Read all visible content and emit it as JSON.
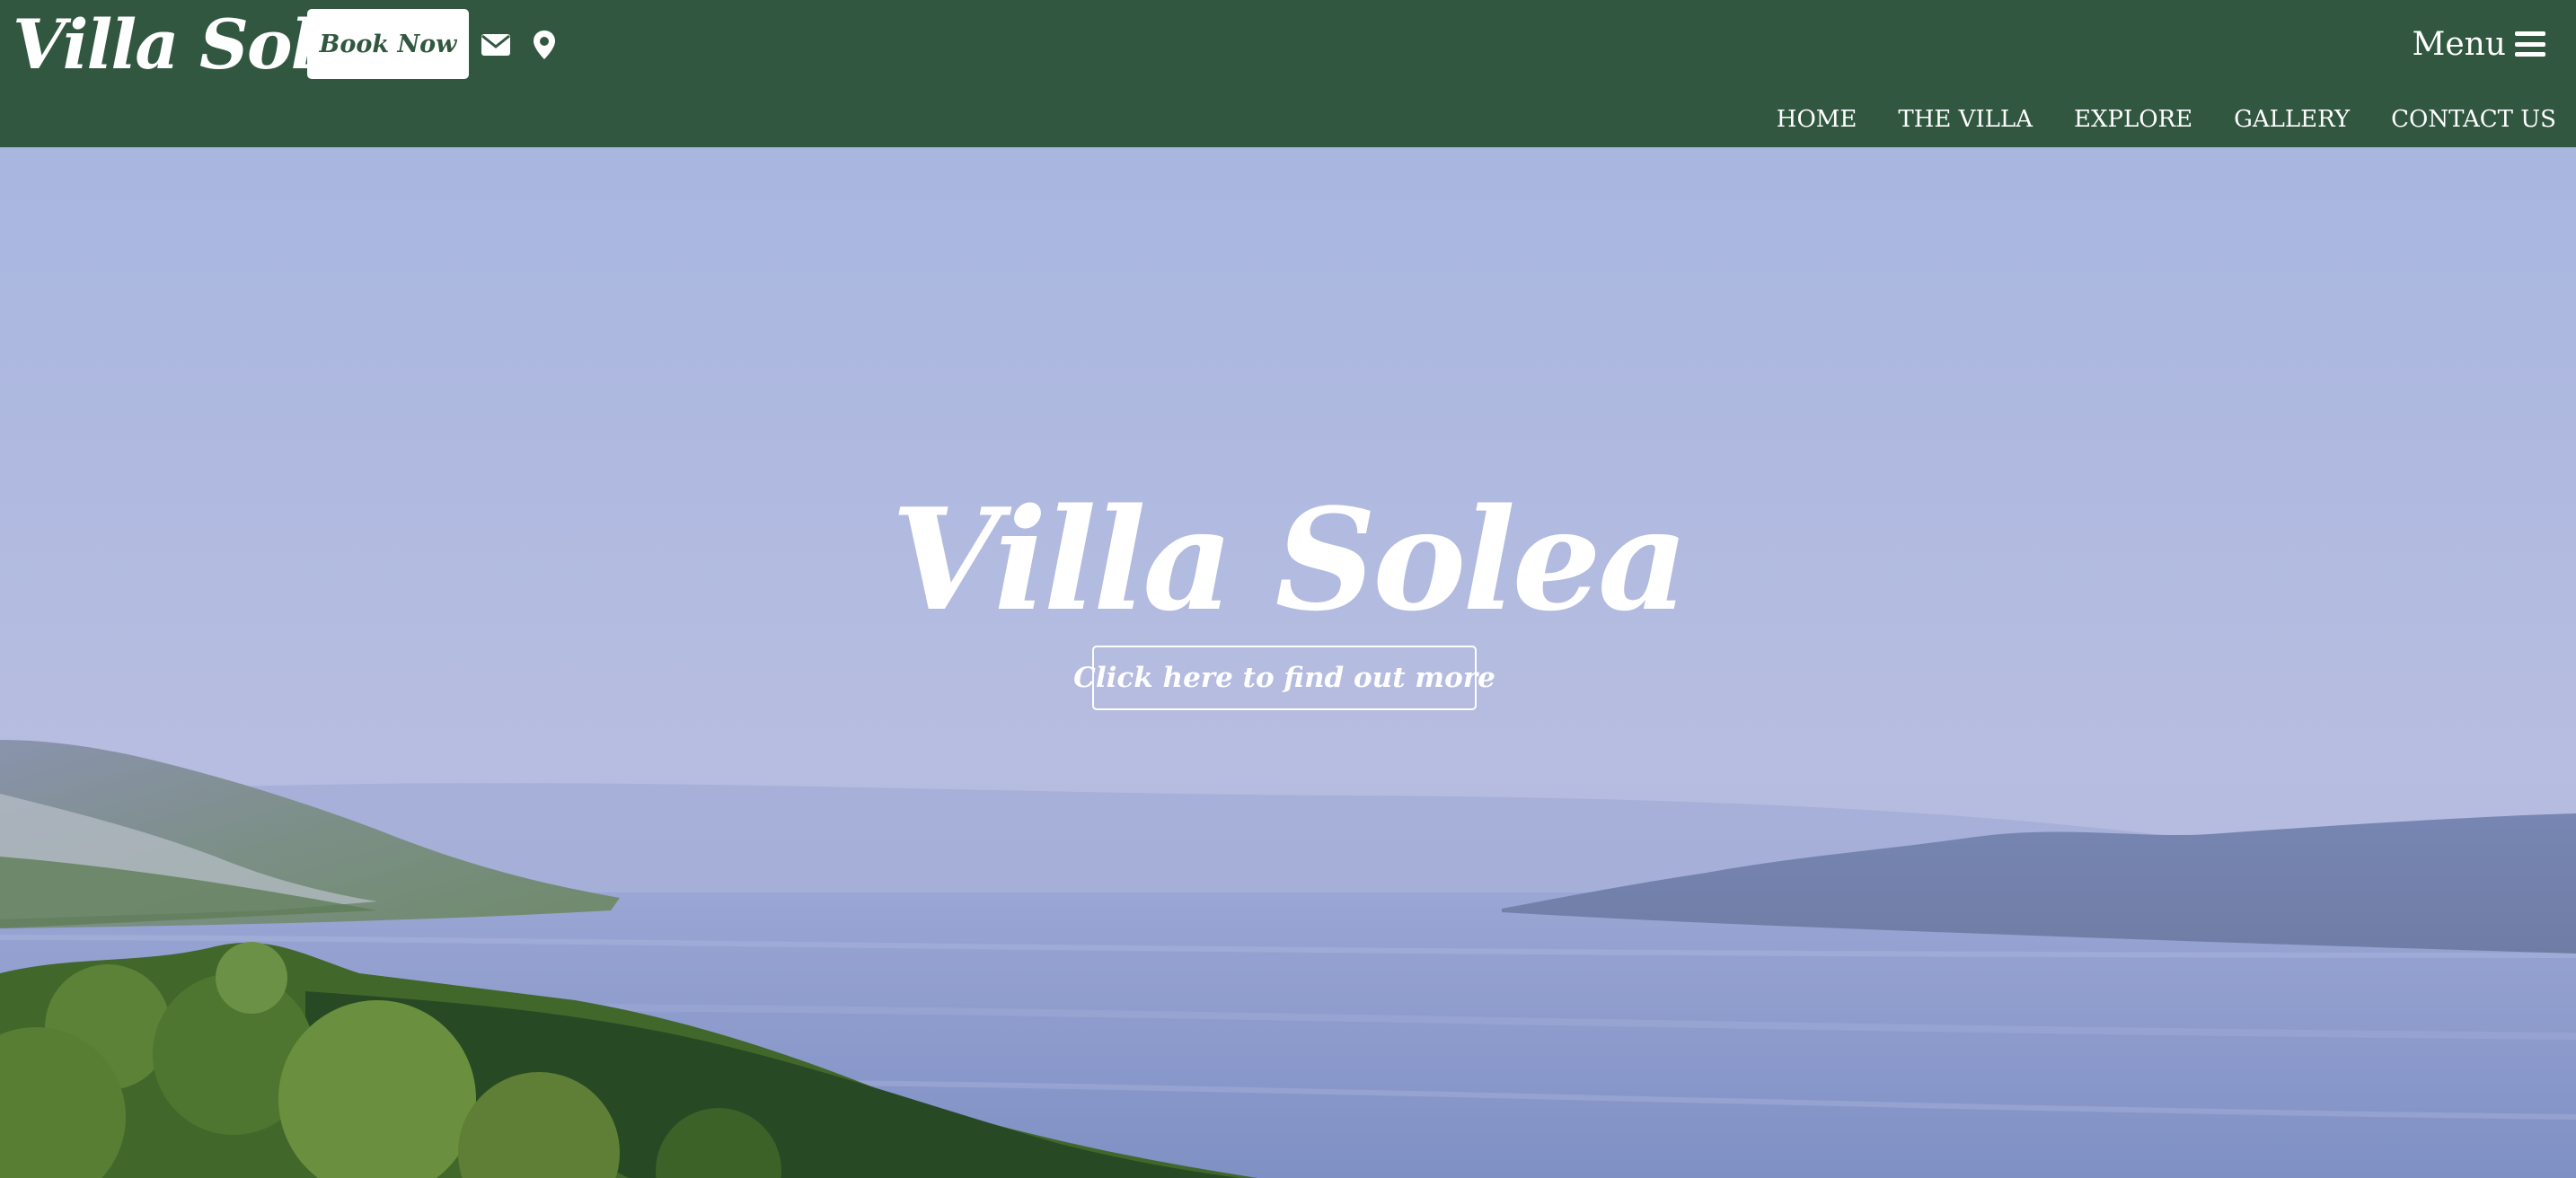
{
  "header": {
    "brand": "Villa Solea",
    "book_button_label": "Book Now",
    "email_icon": "envelope-icon",
    "location_icon": "map-pin-icon",
    "menu_label": "Menu",
    "menu_icon": "hamburger-icon",
    "nav_items": [
      "HOME",
      "THE VILLA",
      "EXPLORE",
      "GALLERY",
      "CONTACT US"
    ]
  },
  "hero": {
    "title": "Villa Solea",
    "cta_label": "Click here to find out more"
  },
  "colors": {
    "header_bg": "#315740",
    "header_text": "#ffffff",
    "button_bg": "#ffffff",
    "button_text": "#315740",
    "sky": "#a9b7dd",
    "sea": "#8b9bcb",
    "foliage": "#3f6a2c"
  }
}
